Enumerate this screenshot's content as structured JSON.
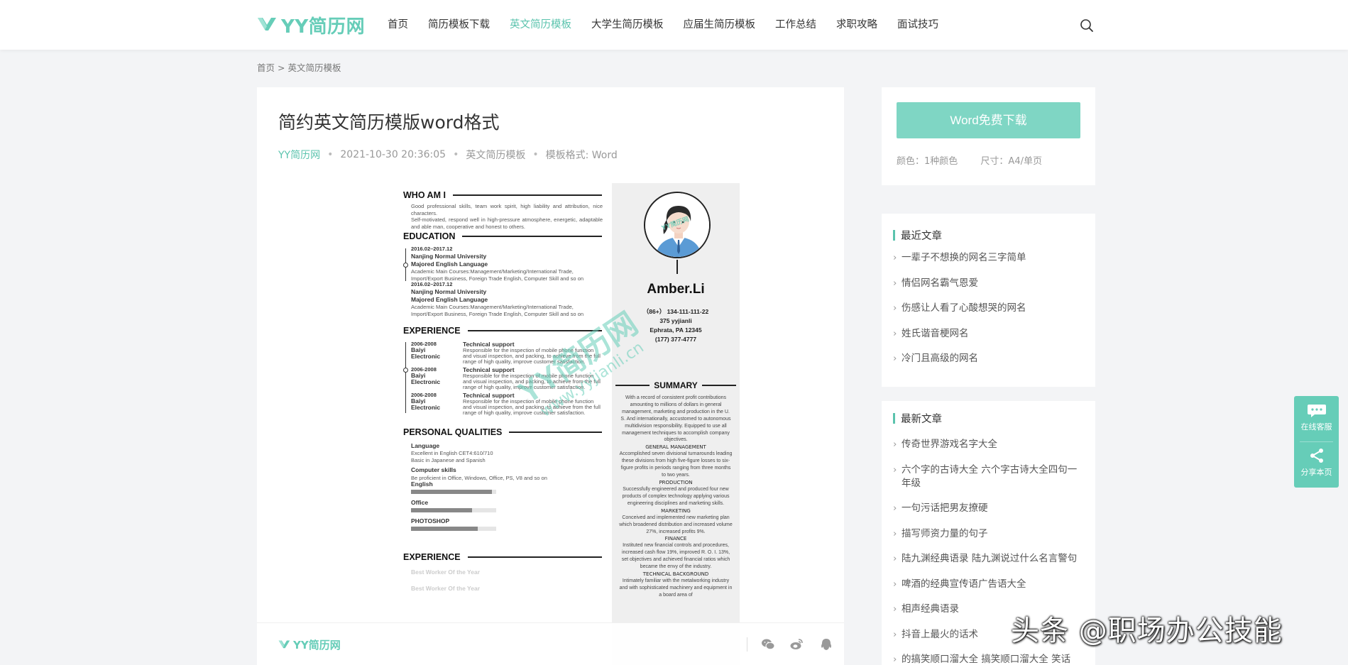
{
  "header": {
    "logo_text": "YY简历网",
    "nav": [
      "首页",
      "简历模板下载",
      "英文简历模板",
      "大学生简历模板",
      "应届生简历模板",
      "工作总结",
      "求职攻略",
      "面试技巧"
    ],
    "active_nav": "英文简历模板",
    "search_icon": "search-icon"
  },
  "breadcrumb": {
    "home": "首页",
    "separator": ">",
    "current": "英文简历模板"
  },
  "article": {
    "title": "简约英文简历模版word格式",
    "author": "YY简历网",
    "date": "2021-10-30 20:36:05",
    "category": "英文简历模板",
    "format": "模板格式: Word"
  },
  "resume": {
    "who_am_i": {
      "heading": "WHO AM I",
      "lines": [
        "Good professional skills, team work spirit, high liability and attribution, nice characters.",
        "Self-motivated, respond well in high-pressure atmosphere, energetic, adaptable and able man, cooperative and honest to others."
      ]
    },
    "education": {
      "heading": "EDUCATION",
      "items": [
        {
          "date": "2016.02–2017.12",
          "school": "Nanjing Normal University",
          "major": "Majored English Language",
          "courses": "Academic Main Courses:Management/Marketing/International Trade, Import/Export Business, Foreign Trade English, Computer Skill and so on"
        },
        {
          "date": "2016.02–2017.12",
          "school": "Nanjing Normal University",
          "major": "Majored English Language",
          "courses": "Academic Main Courses:Management/Marketing/International Trade, Import/Export Business, Foreign Trade English, Computer Skill and so on"
        }
      ]
    },
    "experience": {
      "heading": "EXPERIENCE",
      "items": [
        {
          "date": "2006-2008",
          "company": "Baiyi",
          "dept": "Electronic",
          "role": "Technical support",
          "desc": "Responsible for the inspection of mobile phone function and visual inspection, and packing, to achieve from the full range of high quality, improve customer satisfaction."
        },
        {
          "date": "2006-2008",
          "company": "Baiyi",
          "dept": "Electronic",
          "role": "Technical support",
          "desc": "Responsible for the inspection of mobile phone function and visual inspection, and packing, to achieve from the full range of high quality, improve customer satisfaction."
        },
        {
          "date": "2006-2008",
          "company": "Baiyi",
          "dept": "Electronic",
          "role": "Technical support",
          "desc": "Responsible for the inspection of mobile phone function and visual inspection, and packing, to achieve from the full range of high quality, improve customer satisfaction."
        }
      ]
    },
    "qualities": {
      "heading": "PERSONAL QUALITIES",
      "language_label": "Language",
      "language_lines": [
        "Excellent in English    CET4:610/710",
        "Basic in Japanese and Spanish"
      ],
      "computer_label": "Computer skills",
      "computer_line": "Be proficient in Office, Windows, Office, PS, V8 and so on",
      "skills": [
        {
          "name": "English",
          "level": 0.95
        },
        {
          "name": "Office",
          "level": 0.72
        },
        {
          "name": "PHOTOSHOP",
          "level": 0.78
        }
      ]
    },
    "experience2_heading": "EXPERIENCE",
    "experience2_peek": [
      "Best Worker Of the Year",
      "Best Worker Of the Year"
    ],
    "profile": {
      "name": "Amber.Li",
      "phone": "（86+） 134-111-111-22",
      "address1": "375 yyjianli",
      "address2": "Ephrata, PA 12345",
      "tel": "(177) 377-4777"
    },
    "summary": {
      "heading": "SUMMARY",
      "blocks": [
        {
          "h": "",
          "text": "With a record of consistent profit contributions amounting to millions of dollars in general management, marketing and production in the U. S. And internationally, accustomed to autonomous multidivision responsibility. Equipped to use all management techniques to accomplish company objectives."
        },
        {
          "h": "GENERAL MANAGEMENT",
          "text": "Accomplished seven divisional turnarounds leading these divisions from high five-figure losses to six-figure profits in periods ranging from three months to two years."
        },
        {
          "h": "PRODUCTION",
          "text": "Successfully engineered and produced four new products of complex technology applying various engineering disciplines and marketing skills."
        },
        {
          "h": "MARKETING",
          "text": "Conceived and implemented new marketing plan which broadened distribution and increased volume 27%, increased profits 9%."
        },
        {
          "h": "FINANCE",
          "text": "Instituted new financial controls and procedures, increased cash flow 19%, improved R. O. I. 13%, set objectives and achieved financial ratios which became the envy of the industry."
        },
        {
          "h": "TECHNICAL BACKGROUND",
          "text": "Intimately familiar with the metalworking industry and with sophisticated machinery and equipment in a board area of"
        }
      ]
    },
    "watermark": {
      "main": "YY简历网",
      "sub": "www.yyjianli.cn"
    },
    "avatar_watermark": "YY简历网"
  },
  "bottom_bar": {
    "logo_text": "YY简历网",
    "icons": [
      "wechat-icon",
      "weibo-icon",
      "qq-icon"
    ]
  },
  "download": {
    "button": "Word免费下载",
    "color": "颜色：1种颜色",
    "size": "尺寸：A4/单页",
    "accent": "#7fd6c4"
  },
  "recent": {
    "title": "最近文章",
    "items": [
      "一辈子不想换的网名三字简单",
      "情侣网名霸气恩爱",
      "伤感让人看了心酸想哭的网名",
      "姓氏谐音梗网名",
      "冷门且高级的网名"
    ]
  },
  "latest": {
    "title": "最新文章",
    "items": [
      "传奇世界游戏名字大全",
      "六个字的古诗大全 六个字古诗大全四句一年级",
      "一句污话把男友撩硬",
      "描写师资力量的句子",
      "陆九渊经典语录 陆九渊说过什么名言警句",
      "啤酒的经典宣传语广告语大全",
      "相声经典语录",
      "抖音上最火的话术",
      "的搞笑顺口溜大全 搞笑顺口溜大全 笑话"
    ]
  },
  "floating": {
    "service": "在线客服",
    "share": "分享本页"
  },
  "overlay_watermark": "头条 @职场办公技能",
  "theme": {
    "accent": "#5bc3ad",
    "logo": "#66cdb8",
    "background": "#f3f4f6"
  }
}
